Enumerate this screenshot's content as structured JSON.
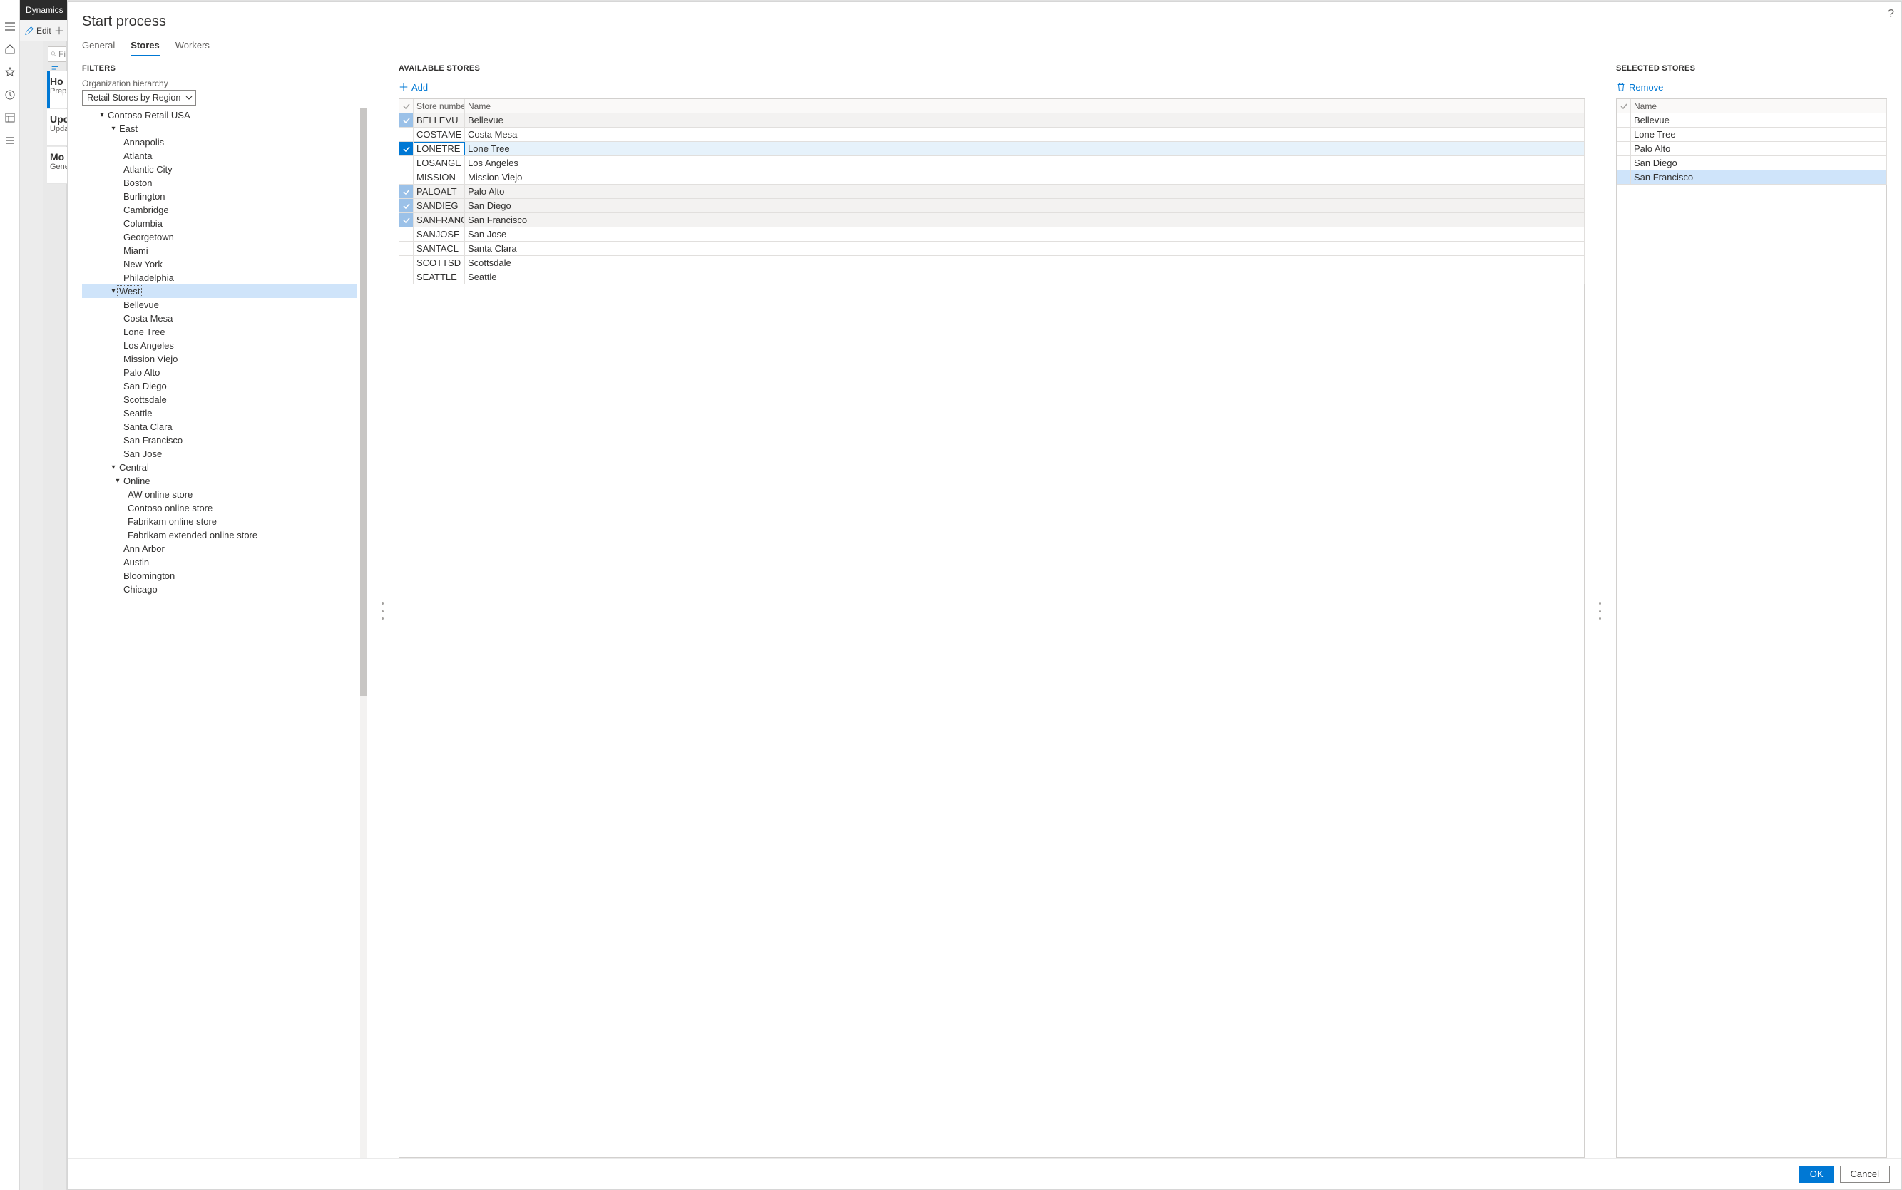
{
  "brand": "Dynamics",
  "chrome": {
    "edit_label": "Edit",
    "filter_placeholder": "Fi"
  },
  "bg_cards": [
    {
      "title": "Ho",
      "sub": "Prep",
      "selected": true
    },
    {
      "title": "Upc",
      "sub": "Upda",
      "selected": false
    },
    {
      "title": "Mo",
      "sub": "Gene",
      "selected": false
    }
  ],
  "modal": {
    "title": "Start process",
    "tabs": [
      {
        "key": "general",
        "label": "General",
        "active": false
      },
      {
        "key": "stores",
        "label": "Stores",
        "active": true
      },
      {
        "key": "workers",
        "label": "Workers",
        "active": false
      }
    ],
    "filters_label": "FILTERS",
    "org_label": "Organization hierarchy",
    "org_value": "Retail Stores by Region",
    "tree": [
      {
        "indent": 1,
        "caret": "down",
        "label": "Contoso Retail USA"
      },
      {
        "indent": 2,
        "caret": "down",
        "label": "East"
      },
      {
        "indent": 3,
        "label": "Annapolis"
      },
      {
        "indent": 3,
        "label": "Atlanta"
      },
      {
        "indent": 3,
        "label": "Atlantic City"
      },
      {
        "indent": 3,
        "label": "Boston"
      },
      {
        "indent": 3,
        "label": "Burlington"
      },
      {
        "indent": 3,
        "label": "Cambridge"
      },
      {
        "indent": 3,
        "label": "Columbia"
      },
      {
        "indent": 3,
        "label": "Georgetown"
      },
      {
        "indent": 3,
        "label": "Miami"
      },
      {
        "indent": 3,
        "label": "New York"
      },
      {
        "indent": 3,
        "label": "Philadelphia"
      },
      {
        "indent": 2,
        "caret": "down",
        "label": "West",
        "selected": true
      },
      {
        "indent": 3,
        "label": "Bellevue"
      },
      {
        "indent": 3,
        "label": "Costa Mesa"
      },
      {
        "indent": 3,
        "label": "Lone Tree"
      },
      {
        "indent": 3,
        "label": "Los Angeles"
      },
      {
        "indent": 3,
        "label": "Mission Viejo"
      },
      {
        "indent": 3,
        "label": "Palo Alto"
      },
      {
        "indent": 3,
        "label": "San Diego"
      },
      {
        "indent": 3,
        "label": "Scottsdale"
      },
      {
        "indent": 3,
        "label": "Seattle"
      },
      {
        "indent": 3,
        "label": "Santa Clara"
      },
      {
        "indent": 3,
        "label": "San Francisco"
      },
      {
        "indent": 3,
        "label": "San Jose"
      },
      {
        "indent": 2,
        "caret": "down",
        "label": "Central"
      },
      {
        "indent": 3,
        "caret": "down",
        "label": "Online"
      },
      {
        "indent": 4,
        "label": "AW online store"
      },
      {
        "indent": 4,
        "label": "Contoso online store"
      },
      {
        "indent": 4,
        "label": "Fabrikam online store"
      },
      {
        "indent": 4,
        "label": "Fabrikam extended online store"
      },
      {
        "indent": 3,
        "label": "Ann Arbor"
      },
      {
        "indent": 3,
        "label": "Austin"
      },
      {
        "indent": 3,
        "label": "Bloomington"
      },
      {
        "indent": 3,
        "label": "Chicago"
      }
    ],
    "available": {
      "title": "AVAILABLE STORES",
      "add_label": "Add",
      "cols": {
        "num": "Store number",
        "name": "Name"
      },
      "rows": [
        {
          "num": "BELLEVU",
          "name": "Bellevue",
          "chk": "dim"
        },
        {
          "num": "COSTAME",
          "name": "Costa Mesa",
          "chk": "off"
        },
        {
          "num": "LONETRE",
          "name": "Lone Tree",
          "chk": "on",
          "current": true
        },
        {
          "num": "LOSANGE",
          "name": "Los Angeles",
          "chk": "off"
        },
        {
          "num": "MISSION",
          "name": "Mission Viejo",
          "chk": "off"
        },
        {
          "num": "PALOALT",
          "name": "Palo Alto",
          "chk": "dim"
        },
        {
          "num": "SANDIEG",
          "name": "San Diego",
          "chk": "dim"
        },
        {
          "num": "SANFRANCIS",
          "name": "San Francisco",
          "chk": "dim"
        },
        {
          "num": "SANJOSE",
          "name": "San Jose",
          "chk": "off"
        },
        {
          "num": "SANTACL",
          "name": "Santa Clara",
          "chk": "off"
        },
        {
          "num": "SCOTTSD",
          "name": "Scottsdale",
          "chk": "off"
        },
        {
          "num": "SEATTLE",
          "name": "Seattle",
          "chk": "off"
        }
      ]
    },
    "selected": {
      "title": "SELECTED STORES",
      "remove_label": "Remove",
      "col_name": "Name",
      "rows": [
        {
          "name": "Bellevue"
        },
        {
          "name": "Lone Tree"
        },
        {
          "name": "Palo Alto"
        },
        {
          "name": "San Diego"
        },
        {
          "name": "San Francisco",
          "highlight": true
        }
      ]
    },
    "footer": {
      "ok": "OK",
      "cancel": "Cancel"
    }
  }
}
